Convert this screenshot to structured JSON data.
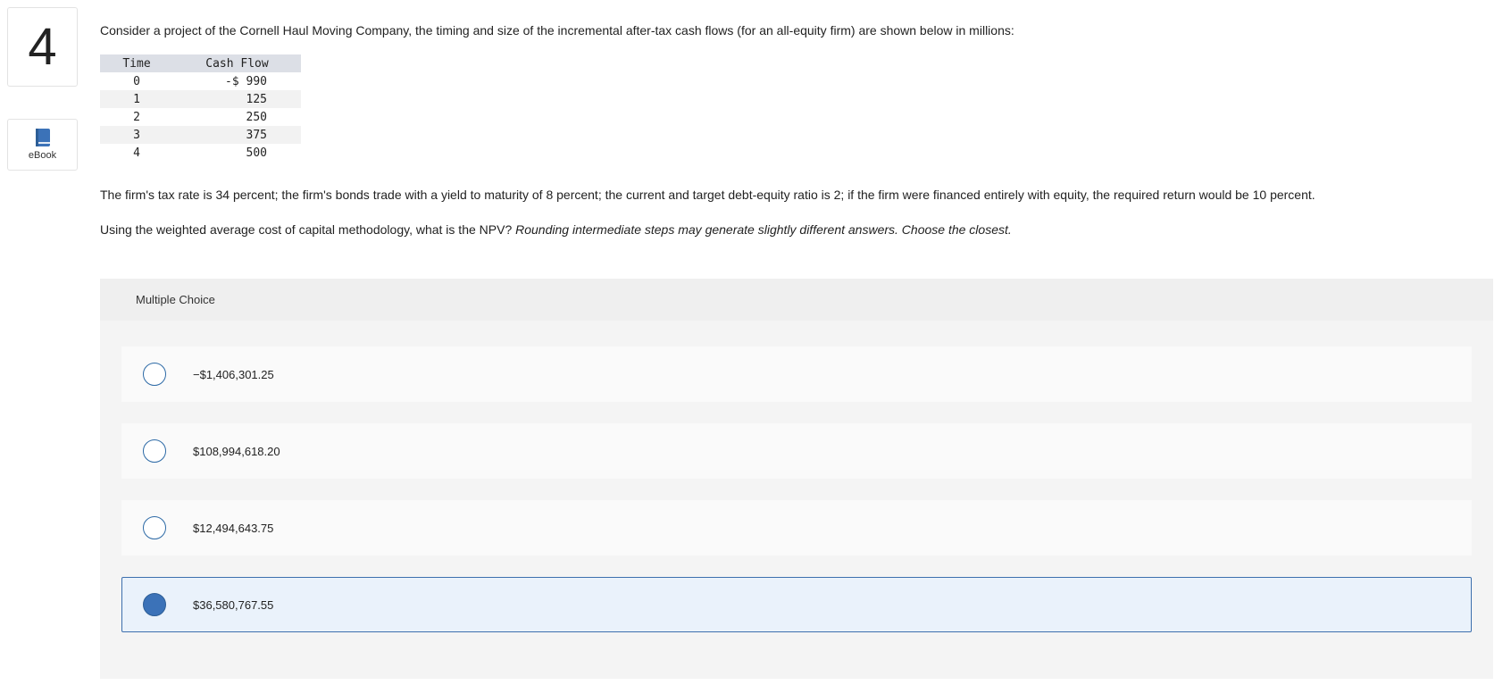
{
  "question": {
    "number": "4",
    "intro": "Consider a project of the Cornell Haul Moving Company, the timing and size of the incremental after-tax cash flows (for an all-equity firm) are shown below in millions:",
    "table": {
      "headers": [
        "Time",
        "Cash Flow"
      ],
      "rows": [
        {
          "time": "0",
          "cash_flow": "-$ 990"
        },
        {
          "time": "1",
          "cash_flow": "125"
        },
        {
          "time": "2",
          "cash_flow": "250"
        },
        {
          "time": "3",
          "cash_flow": "375"
        },
        {
          "time": "4",
          "cash_flow": "500"
        }
      ]
    },
    "paragraph2": "The firm's tax rate is 34 percent; the firm's bonds trade with a yield to maturity of 8 percent; the current and target debt-equity ratio is 2; if the firm were financed entirely with equity, the required return would be 10 percent.",
    "paragraph3_main": "Using the weighted average cost of capital methodology, what is the NPV?",
    "paragraph3_italic": "Rounding intermediate steps may generate slightly different answers. Choose the closest."
  },
  "sidebar": {
    "ebook_label": "eBook",
    "ebook_icon": "book-icon"
  },
  "multiple_choice": {
    "header": "Multiple Choice",
    "options": [
      {
        "label": "−$1,406,301.25",
        "selected": false
      },
      {
        "label": "$108,994,618.20",
        "selected": false
      },
      {
        "label": "$12,494,643.75",
        "selected": false
      },
      {
        "label": "$36,580,767.55",
        "selected": true
      }
    ]
  },
  "colors": {
    "accent": "#3b72b8",
    "selected_bg": "#eaf2fb",
    "table_header_bg": "#dcdfe6"
  }
}
